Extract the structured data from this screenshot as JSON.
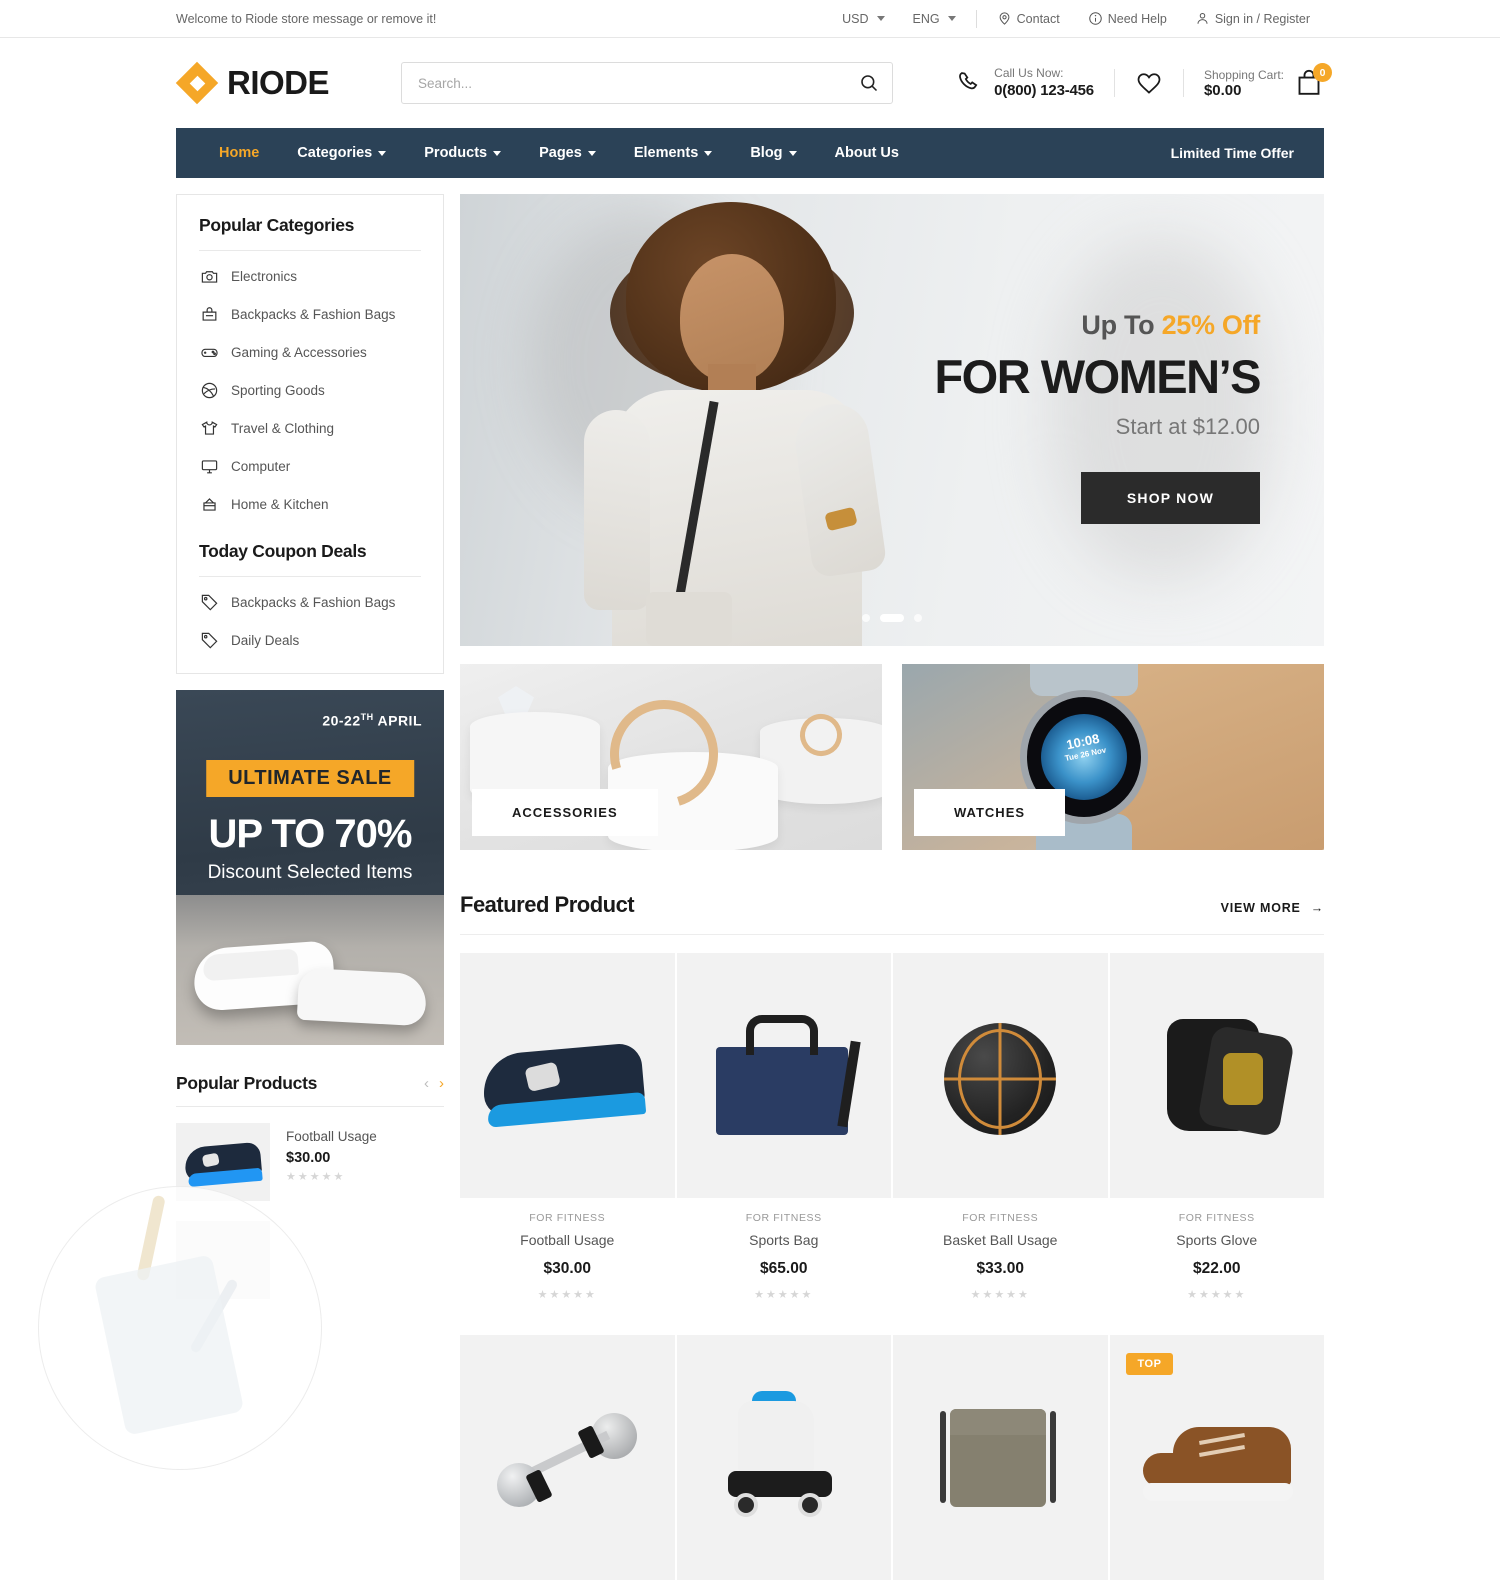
{
  "topbar": {
    "message": "Welcome to Riode store message or remove it!",
    "currency": "USD",
    "language": "ENG",
    "contact": "Contact",
    "need_help": "Need Help",
    "account": "Sign in / Register"
  },
  "header": {
    "logo_text": "RIODE",
    "search_placeholder": "Search...",
    "search_value": "",
    "call_label": "Call Us Now:",
    "call_number": "0(800) 123-456",
    "cart_label": "Shopping Cart:",
    "cart_amount": "$0.00",
    "cart_count": "0"
  },
  "nav": {
    "items": [
      {
        "label": "Home",
        "caret": false,
        "active": true
      },
      {
        "label": "Categories",
        "caret": true,
        "active": false
      },
      {
        "label": "Products",
        "caret": true,
        "active": false
      },
      {
        "label": "Pages",
        "caret": true,
        "active": false
      },
      {
        "label": "Elements",
        "caret": true,
        "active": false
      },
      {
        "label": "Blog",
        "caret": true,
        "active": false
      },
      {
        "label": "About Us",
        "caret": false,
        "active": false
      }
    ],
    "offer": "Limited Time Offer"
  },
  "sidebar": {
    "categories_title": "Popular Categories",
    "categories": [
      {
        "label": "Electronics",
        "icon": "camera-icon"
      },
      {
        "label": "Backpacks & Fashion Bags",
        "icon": "bag-icon"
      },
      {
        "label": "Gaming & Accessories",
        "icon": "gamepad-icon"
      },
      {
        "label": "Sporting Goods",
        "icon": "ball-icon"
      },
      {
        "label": "Travel & Clothing",
        "icon": "tshirt-icon"
      },
      {
        "label": "Computer",
        "icon": "monitor-icon"
      },
      {
        "label": "Home & Kitchen",
        "icon": "pot-icon"
      }
    ],
    "coupon_title": "Today Coupon Deals",
    "coupons": [
      {
        "label": "Backpacks & Fashion Bags",
        "icon": "tag-icon"
      },
      {
        "label": "Daily Deals",
        "icon": "tag-icon"
      }
    ],
    "promo": {
      "date": "20-22",
      "date_sup": "TH",
      "date_month": "APRIL",
      "sale_label": "ULTIMATE SALE",
      "headline": "UP TO 70%",
      "subline": "Discount Selected Items"
    },
    "popular_title": "Popular Products",
    "prev_arrow": "‹",
    "next_arrow": "›",
    "popular_products": [
      {
        "name": "Football Usage",
        "price": "$30.00",
        "stars": "★★★★★"
      }
    ]
  },
  "hero": {
    "up_to": "Up To ",
    "discount": "25% Off",
    "title": "FOR WOMEN’S",
    "start_at": "Start at $12.00",
    "button": "SHOP NOW",
    "dots": [
      "",
      "",
      ""
    ],
    "active_dot": 1
  },
  "category_banners": [
    {
      "label": "ACCESSORIES"
    },
    {
      "label": "WATCHES",
      "watch_time": "10:08",
      "watch_date": "Tue 26 Nov"
    }
  ],
  "featured": {
    "title": "Featured Product",
    "view_more": "VIEW MORE",
    "arrow": "→",
    "row1": [
      {
        "category": "FOR FITNESS",
        "name": "Football Usage",
        "price": "$30.00",
        "stars": "★★★★★",
        "badge": ""
      },
      {
        "category": "FOR FITNESS",
        "name": "Sports Bag",
        "price": "$65.00",
        "stars": "★★★★★",
        "badge": ""
      },
      {
        "category": "FOR FITNESS",
        "name": "Basket Ball Usage",
        "price": "$33.00",
        "stars": "★★★★★",
        "badge": ""
      },
      {
        "category": "FOR FITNESS",
        "name": "Sports Glove",
        "price": "$22.00",
        "stars": "★★★★★",
        "badge": ""
      }
    ],
    "row2_badge": "TOP"
  },
  "colors": {
    "accent": "#f5a728",
    "nav_bg": "#2b4257",
    "dark": "#1a1a1a",
    "tile_bg": "#f2f2f2"
  }
}
